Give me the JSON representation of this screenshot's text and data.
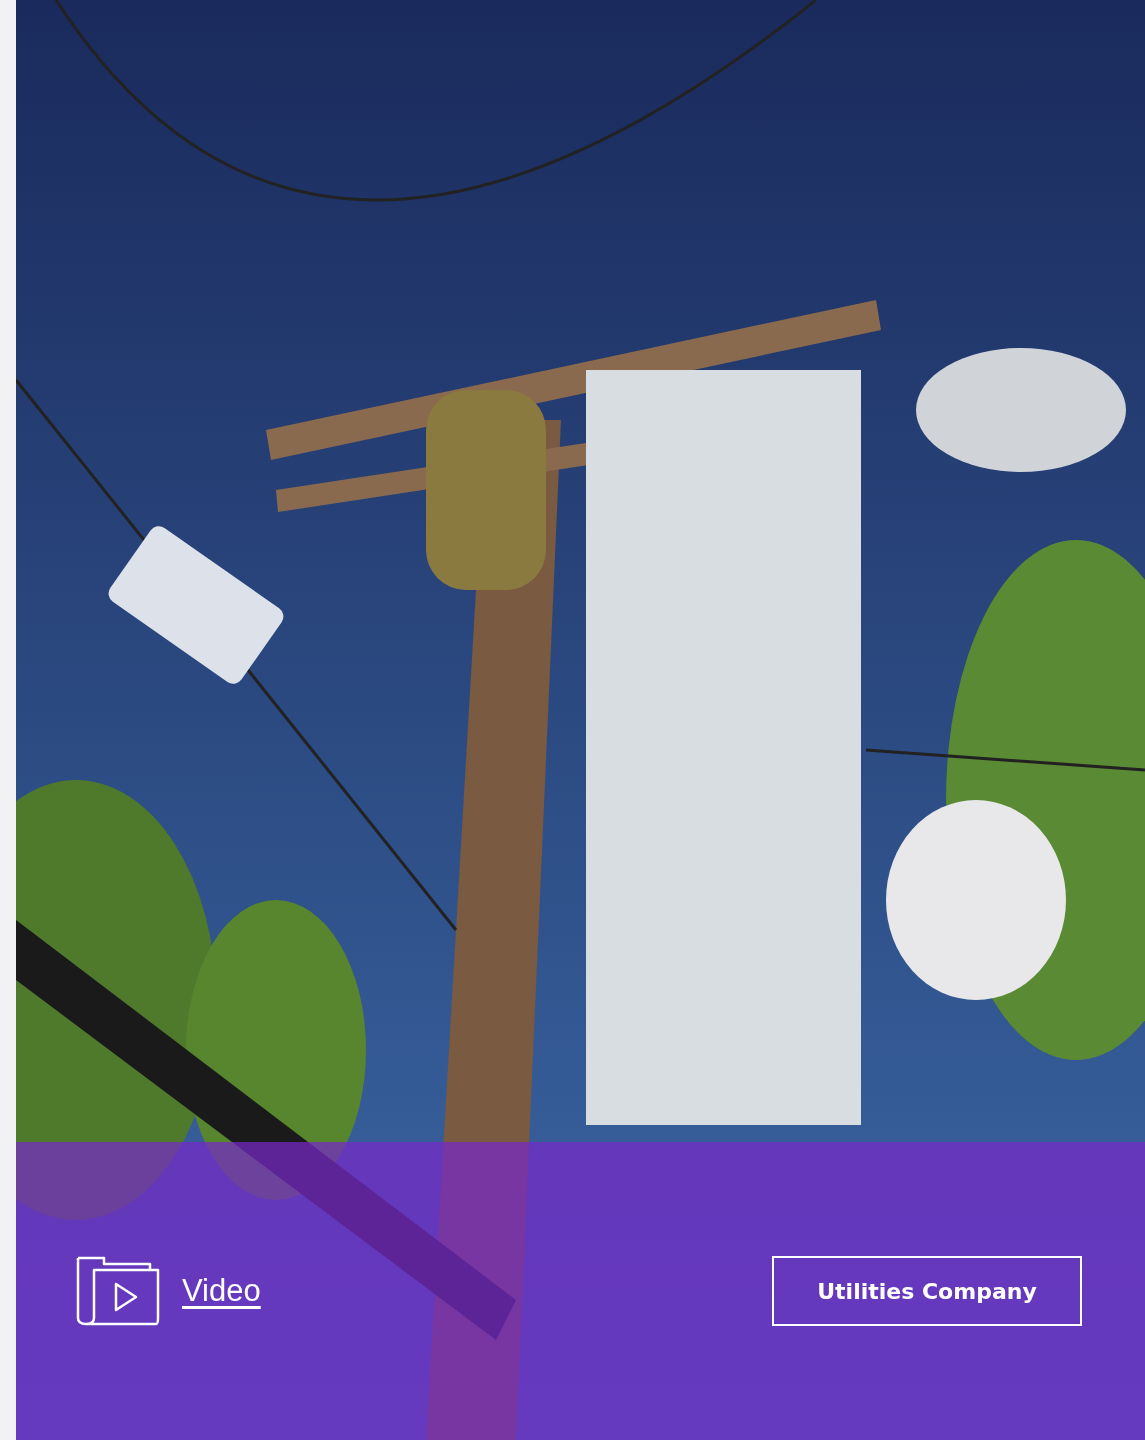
{
  "hero": {
    "link": {
      "label": "Video"
    },
    "tag": {
      "label": "Utilities Company"
    }
  }
}
